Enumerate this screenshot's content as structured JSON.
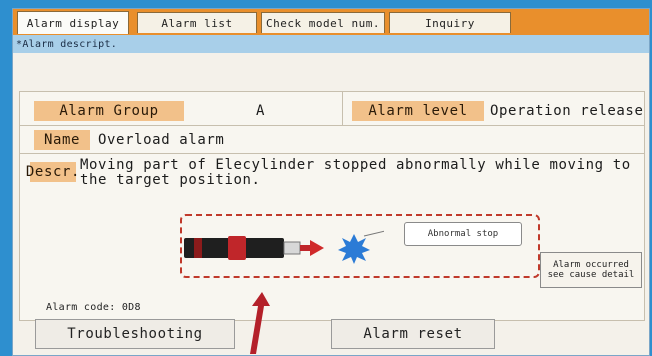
{
  "tabs": [
    {
      "label": "Alarm display",
      "active": true
    },
    {
      "label": "Alarm list",
      "active": false
    },
    {
      "label": "Check model num.",
      "active": false
    },
    {
      "label": "Inquiry",
      "active": false
    }
  ],
  "section_label": "*Alarm descript.",
  "alarm": {
    "group_label": "Alarm Group",
    "group_value": "A",
    "level_label": "Alarm level",
    "level_value": "Operation release",
    "name_label": "Name",
    "name_value": "Overload alarm",
    "descr_label": "Descr.",
    "descr_value": "Moving part of Elecylinder stopped abnormally while moving to the target position.",
    "callout": "Abnormal stop",
    "detail_line1": "Alarm occurred",
    "detail_line2": "see cause detail",
    "code_text": "Alarm code: 0D8"
  },
  "buttons": {
    "troubleshooting": "Troubleshooting",
    "reset": "Alarm reset"
  },
  "colors": {
    "background": "#2e8fcf",
    "tabbar": "#e98f2c",
    "label_bg": "#f2c18a",
    "highlight_dash": "#c0392b"
  }
}
